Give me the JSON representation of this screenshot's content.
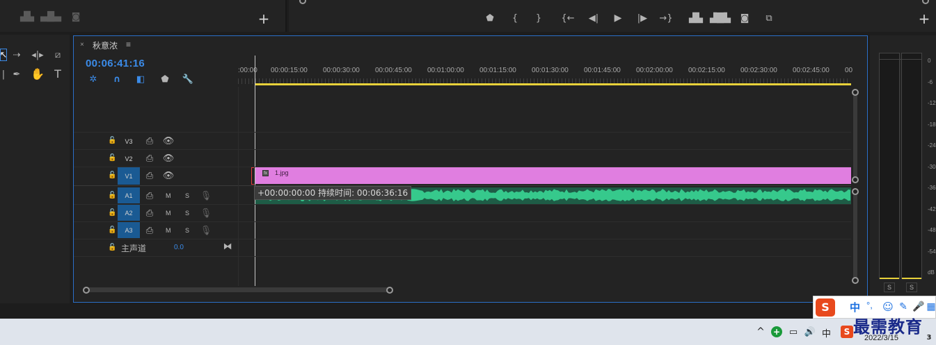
{
  "sequence": {
    "tab_title": "秋意浓",
    "tab_close": "×",
    "tab_menu": "≡",
    "timecode": "00:06:41:16"
  },
  "ruler": {
    "labels": [
      ":00:00",
      "00:00:15:00",
      "00:00:30:00",
      "00:00:45:00",
      "00:01:00:00",
      "00:01:15:00",
      "00:01:30:00",
      "00:01:45:00",
      "00:02:00:00",
      "00:02:15:00",
      "00:02:30:00",
      "00:02:45:00",
      "00"
    ]
  },
  "tracks": {
    "video": [
      {
        "label": "V3",
        "targeted": false
      },
      {
        "label": "V2",
        "targeted": false
      },
      {
        "label": "V1",
        "targeted": true
      }
    ],
    "audio": [
      {
        "label": "A1",
        "m": "M",
        "s": "S"
      },
      {
        "label": "A2",
        "m": "M",
        "s": "S"
      },
      {
        "label": "A3",
        "m": "M",
        "s": "S"
      }
    ],
    "master": {
      "label": "主声道",
      "value": "0.0"
    }
  },
  "clips": {
    "video_clip_name": "1.jpg",
    "tooltip": "+00:00:00:00 持续时间: 00:06:36:16"
  },
  "meter": {
    "scale": [
      "0",
      "-6",
      "-12",
      "-18",
      "-24",
      "-30",
      "-36",
      "-42",
      "-48",
      "-54",
      "dB"
    ],
    "solo_left": "S",
    "solo_right": "S"
  },
  "ime": {
    "chinese_label": "中",
    "punct": "°,",
    "watermark": "最需教育"
  },
  "taskbar": {
    "lang": "中",
    "date": "2022/3/15",
    "badge": "3"
  },
  "colors": {
    "accent": "#3b8be8",
    "video_clip": "#e07ee0",
    "audio_wave": "#36c98c",
    "track_target": "#1a5a93",
    "work_area": "#e8d23a"
  }
}
